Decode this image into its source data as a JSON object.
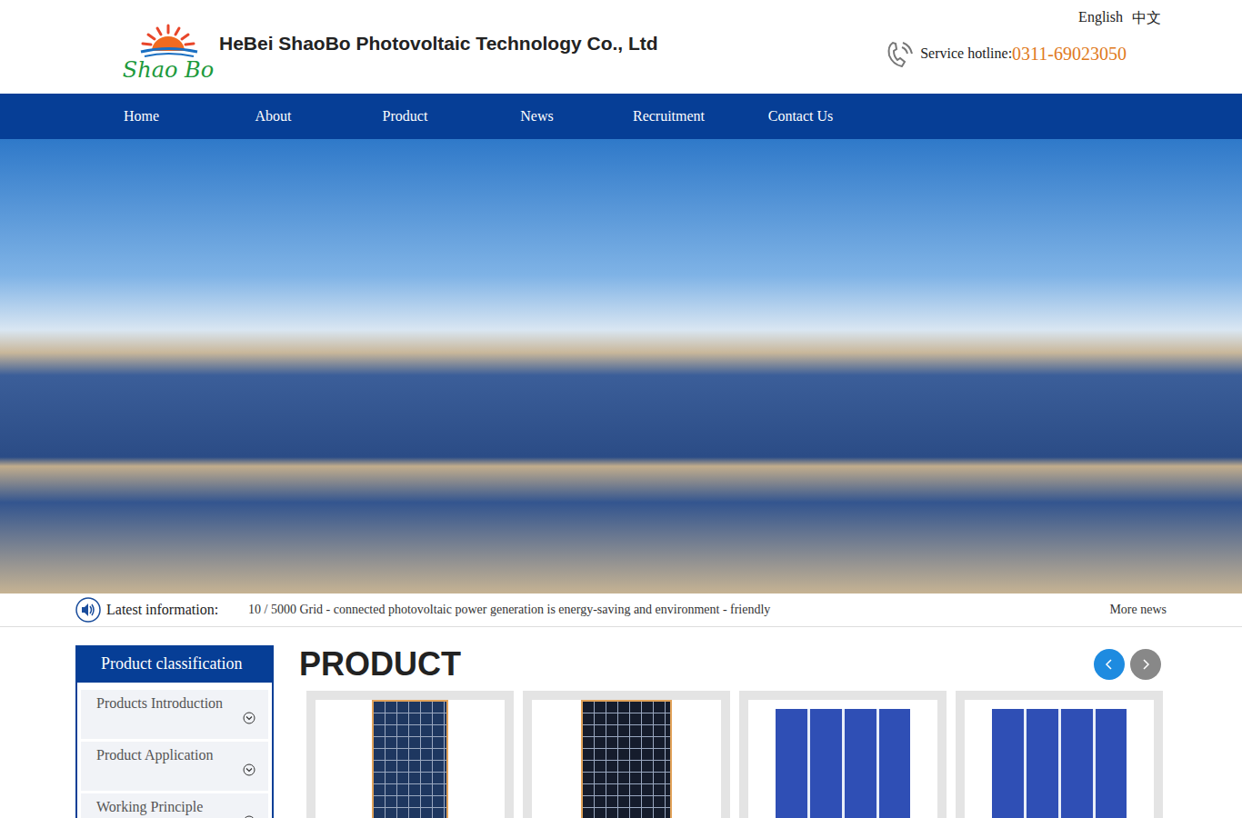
{
  "header": {
    "logo_text": "Shao Bo",
    "company": "HeBei ShaoBo Photovoltaic Technology Co., Ltd",
    "languages": [
      {
        "label": "English"
      },
      {
        "label": "中文"
      }
    ],
    "hotline_label": "Service hotline:",
    "hotline": "0311-69023050"
  },
  "nav": [
    {
      "label": "Home"
    },
    {
      "label": "About"
    },
    {
      "label": "Product"
    },
    {
      "label": "News"
    },
    {
      "label": "Recruitment"
    },
    {
      "label": "Contact Us"
    }
  ],
  "news_bar": {
    "label": "Latest information:",
    "headline": "10 / 5000 Grid - connected photovoltaic power generation is energy-saving and environment - friendly",
    "more": "More news"
  },
  "sidebar": {
    "title": "Product classification",
    "items": [
      {
        "label": "Products Introduction",
        "expanded": false
      },
      {
        "label": "Product Application",
        "expanded": false
      },
      {
        "label": "Working Principle",
        "expanded": false
      }
    ]
  },
  "product": {
    "title": "PRODUCT",
    "arrows": [
      {
        "kind": "prev",
        "active": true
      },
      {
        "kind": "next",
        "active": false
      }
    ],
    "cards": [
      {
        "kind": "module"
      },
      {
        "kind": "module-dark"
      },
      {
        "kind": "cell"
      },
      {
        "kind": "cell"
      }
    ]
  }
}
